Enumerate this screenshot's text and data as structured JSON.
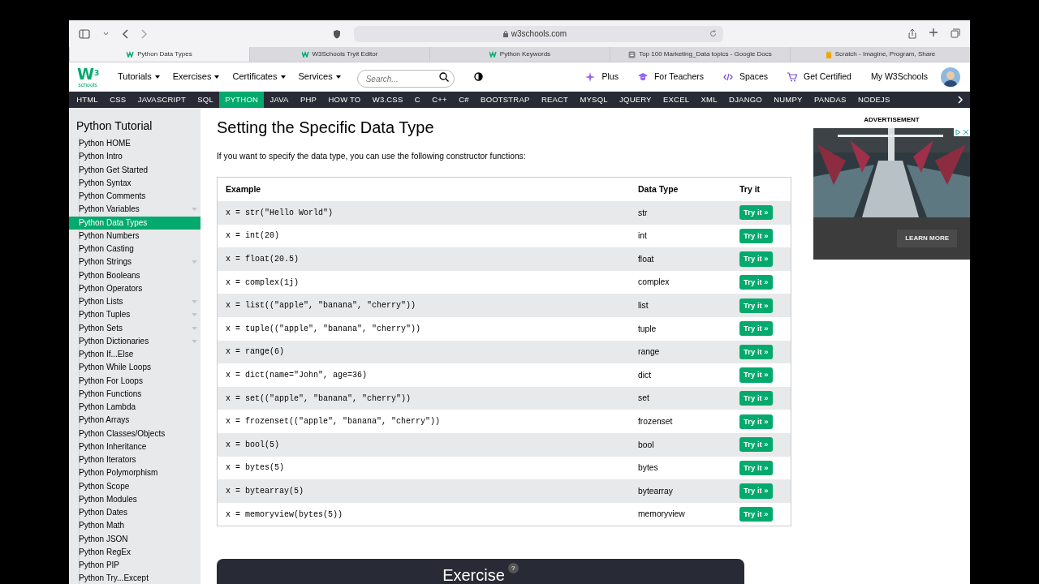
{
  "browser": {
    "address": "w3schools.com",
    "tabs": [
      {
        "label": "Python Data Types",
        "kind": "w3",
        "selected": true
      },
      {
        "label": "W3Schools Tryit Editor",
        "kind": "w3",
        "selected": false
      },
      {
        "label": "Python Keywords",
        "kind": "w3",
        "selected": false
      },
      {
        "label": "Top 100 Marketing_Data topics - Google Docs",
        "kind": "docs",
        "selected": false
      },
      {
        "label": "Scratch - Imagine, Program, Share",
        "kind": "scratch",
        "selected": false
      }
    ]
  },
  "site_nav": {
    "logo": {
      "mark": "W",
      "sup": "3",
      "caption": "schools"
    },
    "menus": [
      "Tutorials",
      "Exercises",
      "Certificates",
      "Services"
    ],
    "search": {
      "placeholder": "Search..."
    },
    "links": [
      {
        "label": "Plus",
        "kind": "sparkle"
      },
      {
        "label": "For Teachers",
        "kind": "cap"
      },
      {
        "label": "Spaces",
        "kind": "code"
      },
      {
        "label": "Get Certified",
        "kind": "cart"
      },
      {
        "label": "My W3Schools",
        "kind": "plain"
      }
    ]
  },
  "subjects": [
    {
      "label": "HTML",
      "selected": false
    },
    {
      "label": "CSS",
      "selected": false
    },
    {
      "label": "JAVASCRIPT",
      "selected": false
    },
    {
      "label": "SQL",
      "selected": false
    },
    {
      "label": "PYTHON",
      "selected": true
    },
    {
      "label": "JAVA",
      "selected": false
    },
    {
      "label": "PHP",
      "selected": false
    },
    {
      "label": "HOW TO",
      "selected": false
    },
    {
      "label": "W3.CSS",
      "selected": false
    },
    {
      "label": "C",
      "selected": false
    },
    {
      "label": "C++",
      "selected": false
    },
    {
      "label": "C#",
      "selected": false
    },
    {
      "label": "BOOTSTRAP",
      "selected": false
    },
    {
      "label": "REACT",
      "selected": false
    },
    {
      "label": "MYSQL",
      "selected": false
    },
    {
      "label": "JQUERY",
      "selected": false
    },
    {
      "label": "EXCEL",
      "selected": false
    },
    {
      "label": "XML",
      "selected": false
    },
    {
      "label": "DJANGO",
      "selected": false
    },
    {
      "label": "NUMPY",
      "selected": false
    },
    {
      "label": "PANDAS",
      "selected": false
    },
    {
      "label": "NODEJS",
      "selected": false
    }
  ],
  "sidebar": {
    "title": "Python Tutorial",
    "items": [
      {
        "label": "Python HOME",
        "selected": false,
        "expandable": false
      },
      {
        "label": "Python Intro",
        "selected": false,
        "expandable": false
      },
      {
        "label": "Python Get Started",
        "selected": false,
        "expandable": false
      },
      {
        "label": "Python Syntax",
        "selected": false,
        "expandable": false
      },
      {
        "label": "Python Comments",
        "selected": false,
        "expandable": false
      },
      {
        "label": "Python Variables",
        "selected": false,
        "expandable": true
      },
      {
        "label": "Python Data Types",
        "selected": true,
        "expandable": false
      },
      {
        "label": "Python Numbers",
        "selected": false,
        "expandable": false
      },
      {
        "label": "Python Casting",
        "selected": false,
        "expandable": false
      },
      {
        "label": "Python Strings",
        "selected": false,
        "expandable": true
      },
      {
        "label": "Python Booleans",
        "selected": false,
        "expandable": false
      },
      {
        "label": "Python Operators",
        "selected": false,
        "expandable": false
      },
      {
        "label": "Python Lists",
        "selected": false,
        "expandable": true
      },
      {
        "label": "Python Tuples",
        "selected": false,
        "expandable": true
      },
      {
        "label": "Python Sets",
        "selected": false,
        "expandable": true
      },
      {
        "label": "Python Dictionaries",
        "selected": false,
        "expandable": true
      },
      {
        "label": "Python If...Else",
        "selected": false,
        "expandable": false
      },
      {
        "label": "Python While Loops",
        "selected": false,
        "expandable": false
      },
      {
        "label": "Python For Loops",
        "selected": false,
        "expandable": false
      },
      {
        "label": "Python Functions",
        "selected": false,
        "expandable": false
      },
      {
        "label": "Python Lambda",
        "selected": false,
        "expandable": false
      },
      {
        "label": "Python Arrays",
        "selected": false,
        "expandable": false
      },
      {
        "label": "Python Classes/Objects",
        "selected": false,
        "expandable": false
      },
      {
        "label": "Python Inheritance",
        "selected": false,
        "expandable": false
      },
      {
        "label": "Python Iterators",
        "selected": false,
        "expandable": false
      },
      {
        "label": "Python Polymorphism",
        "selected": false,
        "expandable": false
      },
      {
        "label": "Python Scope",
        "selected": false,
        "expandable": false
      },
      {
        "label": "Python Modules",
        "selected": false,
        "expandable": false
      },
      {
        "label": "Python Dates",
        "selected": false,
        "expandable": false
      },
      {
        "label": "Python Math",
        "selected": false,
        "expandable": false
      },
      {
        "label": "Python JSON",
        "selected": false,
        "expandable": false
      },
      {
        "label": "Python RegEx",
        "selected": false,
        "expandable": false
      },
      {
        "label": "Python PIP",
        "selected": false,
        "expandable": false
      },
      {
        "label": "Python Try...Except",
        "selected": false,
        "expandable": false
      }
    ]
  },
  "content": {
    "heading": "Setting the Specific Data Type",
    "intro": "If you want to specify the data type, you can use the following constructor functions:",
    "table": {
      "columns": [
        "Example",
        "Data Type",
        "Try it"
      ],
      "rows": [
        {
          "example": "x = str(\"Hello World\")",
          "data_type": "str",
          "button": "Try it »"
        },
        {
          "example": "x = int(20)",
          "data_type": "int",
          "button": "Try it »"
        },
        {
          "example": "x = float(20.5)",
          "data_type": "float",
          "button": "Try it »"
        },
        {
          "example": "x = complex(1j)",
          "data_type": "complex",
          "button": "Try it »"
        },
        {
          "example": "x = list((\"apple\", \"banana\", \"cherry\"))",
          "data_type": "list",
          "button": "Try it »"
        },
        {
          "example": "x = tuple((\"apple\", \"banana\", \"cherry\"))",
          "data_type": "tuple",
          "button": "Try it »"
        },
        {
          "example": "x = range(6)",
          "data_type": "range",
          "button": "Try it »"
        },
        {
          "example": "x = dict(name=\"John\", age=36)",
          "data_type": "dict",
          "button": "Try it »"
        },
        {
          "example": "x = set((\"apple\", \"banana\", \"cherry\"))",
          "data_type": "set",
          "button": "Try it »"
        },
        {
          "example": "x = frozenset((\"apple\", \"banana\", \"cherry\"))",
          "data_type": "frozenset",
          "button": "Try it »"
        },
        {
          "example": "x = bool(5)",
          "data_type": "bool",
          "button": "Try it »"
        },
        {
          "example": "x = bytes(5)",
          "data_type": "bytes",
          "button": "Try it »"
        },
        {
          "example": "x = bytearray(5)",
          "data_type": "bytearray",
          "button": "Try it »"
        },
        {
          "example": "x = memoryview(bytes(5))",
          "data_type": "memoryview",
          "button": "Try it »"
        }
      ]
    },
    "exercise": {
      "title": "Exercise",
      "help": "?"
    }
  },
  "ad": {
    "label": "ADVERTISEMENT",
    "button": "LEARN MORE"
  }
}
